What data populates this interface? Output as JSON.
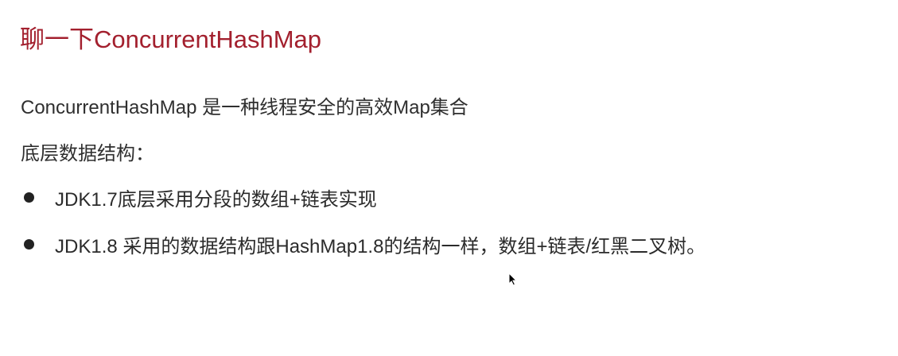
{
  "slide": {
    "title": "聊一下ConcurrentHashMap",
    "intro": "ConcurrentHashMap 是一种线程安全的高效Map集合",
    "subheading": "底层数据结构：",
    "bullets": [
      "JDK1.7底层采用分段的数组+链表实现",
      "JDK1.8 采用的数据结构跟HashMap1.8的结构一样，数组+链表/红黑二叉树。"
    ]
  },
  "colors": {
    "title": "#a3202e",
    "text": "#2f2f2f"
  }
}
